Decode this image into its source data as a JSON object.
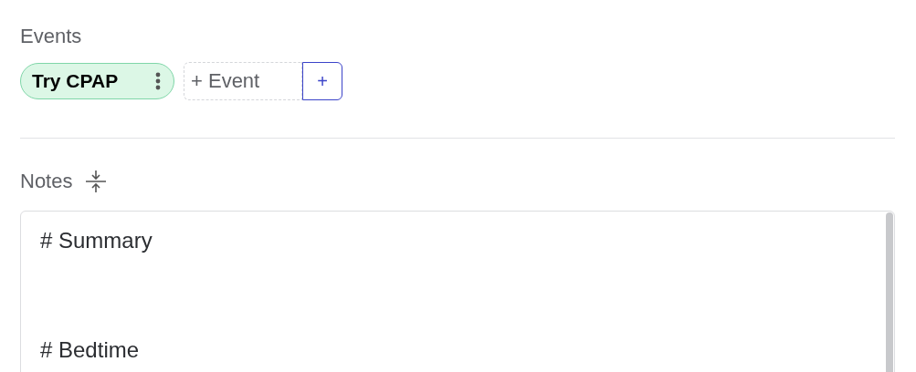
{
  "events": {
    "label": "Events",
    "items": [
      {
        "label": "Try CPAP"
      }
    ],
    "new_event": {
      "placeholder": "+ Event"
    },
    "add_button": "+"
  },
  "notes": {
    "label": "Notes",
    "content": [
      "# Summary",
      "# Bedtime"
    ]
  }
}
